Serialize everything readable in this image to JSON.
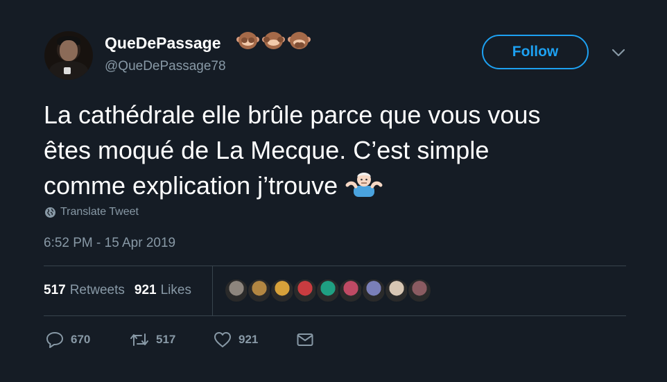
{
  "user": {
    "display_name": "QueDePassage",
    "emoji": [
      "see-no-evil-monkey",
      "hear-no-evil-monkey",
      "speak-no-evil-monkey"
    ],
    "handle": "@QueDePassage78"
  },
  "follow_button": {
    "label": "Follow"
  },
  "tweet": {
    "lines": [
      "La cathédrale elle brûle parce que vous vous",
      "êtes moqué de La Mecque. C’est simple",
      "comme explication j’trouve"
    ],
    "trailing_emoji": "man-shrugging",
    "translate_label": "Translate Tweet",
    "timestamp": "6:52 PM - 15 Apr 2019"
  },
  "stats": {
    "retweets_count": "517",
    "retweets_label": "Retweets",
    "likes_count": "921",
    "likes_label": "Likes"
  },
  "likers": [
    {
      "color": "#8d857d"
    },
    {
      "color": "#b28642"
    },
    {
      "color": "#d7a13a"
    },
    {
      "color": "#c93c40"
    },
    {
      "color": "#1f9f82"
    },
    {
      "color": "#bf4a64"
    },
    {
      "color": "#7a7fb8"
    },
    {
      "color": "#d7c6b3"
    },
    {
      "color": "#8a5b61"
    }
  ],
  "actions": {
    "reply_count": "670",
    "retweet_count": "517",
    "like_count": "921"
  },
  "colors": {
    "background": "#151c25",
    "accent": "#1da1f2",
    "muted": "#8899a6",
    "divider": "#38444d"
  }
}
